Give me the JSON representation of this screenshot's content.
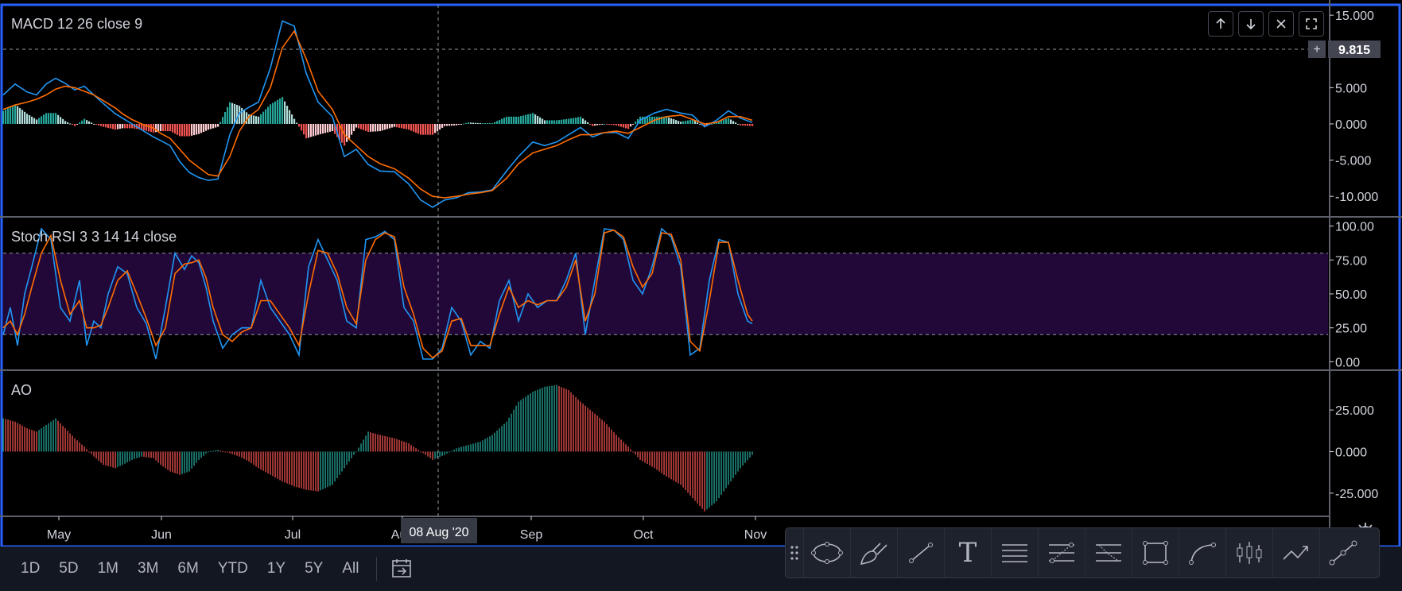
{
  "chart_data": [
    {
      "type": "line",
      "title": "MACD 12 26 close 9",
      "ylim": [
        -12.5,
        16
      ],
      "y_ticks": [
        "15.000",
        "5.000",
        "0.000",
        "-5.000",
        "-10.000"
      ],
      "crosshair_value": "9.815",
      "series": [
        {
          "color": "#2196f3",
          "x": [
            0,
            5,
            10,
            14,
            18,
            22,
            26,
            30,
            34,
            38,
            42,
            47,
            50,
            54,
            58,
            63,
            66,
            70,
            74,
            78,
            82,
            86,
            90,
            95,
            99,
            103,
            107,
            112,
            117,
            122,
            127,
            132,
            138,
            143,
            148,
            153,
            158,
            164,
            170,
            175,
            180,
            185,
            190,
            195,
            200,
            205,
            211,
            216,
            222,
            227,
            232,
            237,
            242,
            247,
            252,
            257,
            262,
            267,
            273,
            278,
            284,
            289,
            294,
            299,
            304,
            309,
            314
          ],
          "y": [
            4.0,
            5.5,
            4.4,
            4.0,
            5.5,
            6.3,
            5.6,
            4.7,
            5.2,
            4.0,
            2.8,
            1.4,
            0.8,
            0,
            -0.8,
            -1.8,
            -2.3,
            -3.0,
            -5.2,
            -6.7,
            -7.4,
            -7.8,
            -7.6,
            -1.5,
            1.5,
            2.3,
            3.0,
            7.7,
            14.2,
            13.5,
            7.0,
            3.0,
            1.0,
            -4.5,
            -3.5,
            -5.6,
            -6.5,
            -6.6,
            -8.3,
            -10.5,
            -11.5,
            -10.5,
            -10.2,
            -9.5,
            -9.4,
            -9.1,
            -6.5,
            -4.5,
            -2.5,
            -3.0,
            -2.5,
            -1.5,
            -0.5,
            -1.8,
            -1.2,
            -1.2,
            -2.0,
            0.5,
            1.5,
            2.0,
            1.5,
            1.2,
            -0.4,
            0.5,
            1.8,
            0.8,
            0.2
          ]
        },
        {
          "color": "#ff6d00",
          "x": [
            0,
            5,
            10,
            14,
            18,
            22,
            26,
            30,
            34,
            38,
            42,
            47,
            50,
            54,
            58,
            63,
            66,
            70,
            74,
            78,
            82,
            86,
            90,
            95,
            99,
            103,
            107,
            112,
            117,
            122,
            127,
            132,
            138,
            143,
            148,
            153,
            158,
            164,
            170,
            175,
            180,
            185,
            190,
            195,
            200,
            205,
            211,
            216,
            222,
            227,
            232,
            237,
            242,
            247,
            252,
            257,
            262,
            267,
            273,
            278,
            284,
            289,
            294,
            299,
            304,
            309,
            314
          ],
          "y": [
            2.0,
            2.6,
            3.0,
            3.4,
            4.0,
            4.8,
            5.2,
            5.0,
            4.5,
            4.0,
            3.2,
            2.2,
            1.4,
            0.6,
            0,
            -0.6,
            -1.3,
            -2.0,
            -3.5,
            -5.0,
            -6.0,
            -7.0,
            -7.2,
            -4.5,
            -1.0,
            1.0,
            2.0,
            5.0,
            10.5,
            12.8,
            9.0,
            4.5,
            2.0,
            -1.5,
            -3.0,
            -4.5,
            -5.5,
            -6.2,
            -7.5,
            -9.0,
            -10.0,
            -10.2,
            -10.0,
            -9.7,
            -9.5,
            -9.2,
            -7.5,
            -5.5,
            -4.0,
            -3.5,
            -3.0,
            -2.2,
            -1.5,
            -1.5,
            -1.2,
            -1.0,
            -1.3,
            -0.5,
            0.5,
            1.0,
            1.2,
            0.6,
            0.0,
            0.2,
            1.0,
            1.0,
            0.5
          ]
        }
      ],
      "histogram": {
        "up_color": "#26a69a",
        "down_color": "#ef5350",
        "light_up": "#b2dfdb",
        "light_down": "#ffcdd2",
        "x": [
          0,
          5,
          10,
          14,
          18,
          22,
          26,
          30,
          34,
          38,
          42,
          47,
          50,
          54,
          58,
          63,
          66,
          70,
          74,
          78,
          82,
          86,
          90,
          95,
          99,
          103,
          107,
          112,
          117,
          122,
          127,
          132,
          138,
          143,
          148,
          153,
          158,
          164,
          170,
          175,
          180,
          185,
          190,
          195,
          200,
          205,
          211,
          216,
          222,
          227,
          232,
          237,
          242,
          247,
          252,
          257,
          262,
          267,
          273,
          278,
          284,
          289,
          294,
          299,
          304,
          309,
          314
        ],
        "values": [
          1.8,
          2.7,
          1.4,
          0.6,
          1.5,
          1.5,
          0.4,
          -0.3,
          0.7,
          0,
          -0.4,
          -0.8,
          -0.6,
          -0.6,
          -0.8,
          -1.2,
          -1.0,
          -1.0,
          -1.7,
          -1.7,
          -1.4,
          -0.8,
          -0.4,
          3.0,
          2.5,
          1.3,
          1.0,
          2.7,
          3.7,
          0.7,
          -2.0,
          -1.5,
          -1.0,
          -3.0,
          -0.5,
          -1.1,
          -1.0,
          -0.4,
          -0.8,
          -1.5,
          -1.5,
          -0.3,
          -0.2,
          0.2,
          0.1,
          0.1,
          1.0,
          1.0,
          1.5,
          0.5,
          0.5,
          0.7,
          1.0,
          -0.3,
          0,
          -0.2,
          -0.7,
          1.0,
          1.0,
          1.0,
          0.3,
          0.6,
          -0.4,
          0.3,
          0.8,
          -0.2,
          -0.3
        ]
      }
    },
    {
      "type": "line",
      "title": "Stoch RSI 3 3 14 14 close",
      "ylim": [
        -5,
        105
      ],
      "y_ticks": [
        "100.00",
        "75.00",
        "50.00",
        "25.00",
        "0.00"
      ],
      "band": [
        20,
        80
      ],
      "series": [
        {
          "color": "#2196f3",
          "x": [
            0,
            3,
            6,
            9,
            12,
            16,
            20,
            24,
            28,
            32,
            35,
            38,
            41,
            44,
            48,
            52,
            56,
            60,
            64,
            68,
            72,
            76,
            79,
            82,
            85,
            88,
            92,
            96,
            100,
            104,
            108,
            112,
            116,
            120,
            124,
            128,
            132,
            136,
            140,
            144,
            148,
            152,
            156,
            160,
            164,
            168,
            172,
            176,
            180,
            184,
            188,
            192,
            196,
            200,
            204,
            208,
            212,
            216,
            220,
            224,
            228,
            232,
            236,
            240,
            244,
            248,
            252,
            256,
            260,
            264,
            268,
            272,
            276,
            280,
            284,
            288,
            292,
            296,
            300,
            304,
            308,
            312,
            314
          ],
          "y": [
            20,
            40,
            12,
            50,
            70,
            98,
            90,
            40,
            30,
            60,
            12,
            30,
            25,
            50,
            70,
            65,
            40,
            28,
            2,
            40,
            80,
            68,
            78,
            73,
            55,
            30,
            10,
            20,
            25,
            25,
            60,
            40,
            30,
            20,
            5,
            70,
            90,
            75,
            60,
            30,
            25,
            90,
            92,
            96,
            90,
            40,
            30,
            2,
            2,
            10,
            40,
            30,
            5,
            15,
            10,
            45,
            60,
            30,
            50,
            40,
            45,
            45,
            60,
            80,
            20,
            60,
            98,
            97,
            90,
            60,
            50,
            70,
            98,
            92,
            70,
            5,
            10,
            60,
            90,
            88,
            50,
            30,
            28
          ]
        },
        {
          "color": "#ff6d00",
          "x": [
            0,
            3,
            6,
            9,
            12,
            16,
            20,
            24,
            28,
            32,
            35,
            38,
            41,
            44,
            48,
            52,
            56,
            60,
            64,
            68,
            72,
            76,
            79,
            82,
            85,
            88,
            92,
            96,
            100,
            104,
            108,
            112,
            116,
            120,
            124,
            128,
            132,
            136,
            140,
            144,
            148,
            152,
            156,
            160,
            164,
            168,
            172,
            176,
            180,
            184,
            188,
            192,
            196,
            200,
            204,
            208,
            212,
            216,
            220,
            224,
            228,
            232,
            236,
            240,
            244,
            248,
            252,
            256,
            260,
            264,
            268,
            272,
            276,
            280,
            284,
            288,
            292,
            296,
            300,
            304,
            308,
            312,
            314
          ],
          "y": [
            25,
            30,
            20,
            35,
            55,
            80,
            93,
            60,
            35,
            45,
            25,
            25,
            27,
            40,
            60,
            67,
            50,
            32,
            12,
            25,
            65,
            72,
            73,
            75,
            62,
            40,
            20,
            15,
            22,
            25,
            45,
            45,
            35,
            25,
            12,
            50,
            82,
            80,
            65,
            40,
            28,
            75,
            90,
            95,
            92,
            55,
            35,
            10,
            3,
            8,
            30,
            32,
            12,
            12,
            12,
            35,
            55,
            40,
            45,
            42,
            45,
            45,
            55,
            75,
            30,
            50,
            95,
            97,
            92,
            70,
            55,
            65,
            95,
            94,
            75,
            15,
            8,
            45,
            88,
            88,
            60,
            35,
            30
          ]
        }
      ]
    },
    {
      "type": "bar",
      "title": "AO",
      "ylim": [
        -38,
        48
      ],
      "y_ticks": [
        "25.000",
        "0.000",
        "-25.000"
      ],
      "up_color": "#26a69a",
      "down_color": "#ef5350",
      "x": [
        0,
        5,
        10,
        14,
        18,
        22,
        26,
        30,
        34,
        38,
        42,
        47,
        50,
        54,
        58,
        63,
        66,
        70,
        74,
        78,
        82,
        86,
        90,
        95,
        99,
        103,
        107,
        112,
        117,
        122,
        127,
        132,
        138,
        143,
        148,
        153,
        158,
        164,
        170,
        175,
        180,
        185,
        190,
        195,
        200,
        205,
        211,
        216,
        222,
        227,
        232,
        237,
        242,
        247,
        252,
        257,
        262,
        267,
        273,
        278,
        284,
        289,
        294,
        299,
        304,
        309,
        314
      ],
      "values": [
        20,
        18,
        14,
        12,
        16,
        20,
        14,
        8,
        3,
        -3,
        -8,
        -10,
        -8,
        -5,
        -3,
        -4,
        -8,
        -12,
        -14,
        -12,
        -5,
        0,
        1,
        -1,
        -3,
        -6,
        -10,
        -14,
        -18,
        -21,
        -23,
        -24,
        -20,
        -10,
        0,
        12,
        10,
        8,
        5,
        0,
        -5,
        -2,
        2,
        4,
        6,
        10,
        18,
        30,
        36,
        39,
        40,
        37,
        30,
        24,
        18,
        10,
        3,
        -5,
        -10,
        -15,
        -20,
        -28,
        -36,
        -30,
        -20,
        -10,
        -2
      ]
    }
  ],
  "x_axis": {
    "labels": [
      "May",
      "Jun",
      "Jul",
      "Aug",
      "Sep",
      "Oct",
      "Nov"
    ],
    "crosshair_label": "08 Aug '20"
  },
  "periods": [
    "1D",
    "5D",
    "1M",
    "3M",
    "6M",
    "YTD",
    "1Y",
    "5Y",
    "All"
  ],
  "toolbar_icons": [
    "ellipse-icon",
    "brush-icon",
    "trend-line-icon",
    "text-icon",
    "horizontal-lines-icon",
    "fib-retracement-icon",
    "fib-extension-icon",
    "rectangle-icon",
    "curve-icon",
    "candlestick-icon",
    "forecast-icon",
    "ruler-icon"
  ],
  "toolbar_text_tool": "T",
  "pane_buttons": [
    "move-up-icon",
    "move-down-icon",
    "close-icon",
    "maximize-icon"
  ],
  "colors": {
    "background": "#000000",
    "border": "#2962ff",
    "stoch_band": "#220839",
    "axis_text": "#d1d4dc",
    "crosshair_bg": "#363a45"
  }
}
